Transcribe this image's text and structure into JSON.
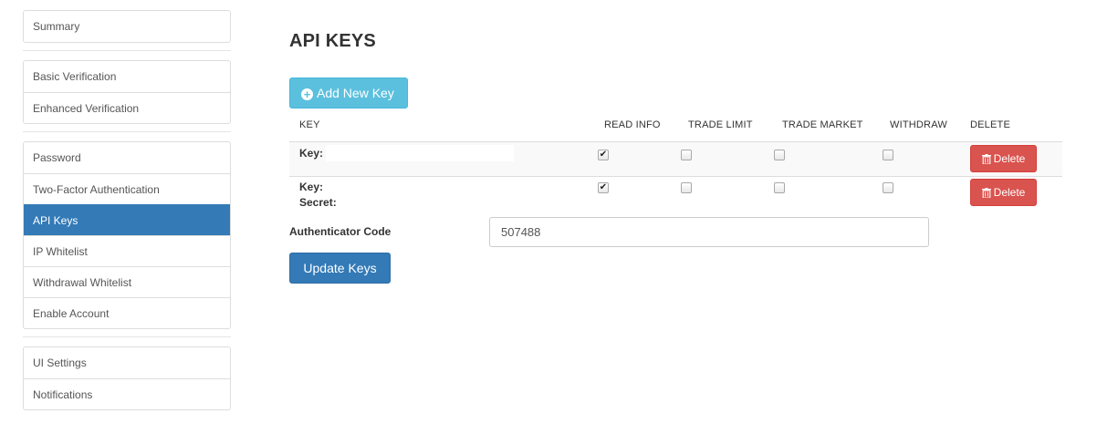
{
  "sidebar": {
    "groups": [
      {
        "items": [
          {
            "label": "Summary"
          }
        ]
      },
      {
        "items": [
          {
            "label": "Basic Verification"
          },
          {
            "label": "Enhanced Verification"
          }
        ]
      },
      {
        "items": [
          {
            "label": "Password"
          },
          {
            "label": "Two-Factor Authentication"
          },
          {
            "label": "API Keys",
            "active": true
          },
          {
            "label": "IP Whitelist"
          },
          {
            "label": "Withdrawal Whitelist"
          },
          {
            "label": "Enable Account"
          }
        ]
      },
      {
        "items": [
          {
            "label": "UI Settings"
          },
          {
            "label": "Notifications"
          }
        ]
      }
    ]
  },
  "main": {
    "title": "API KEYS",
    "add_key_label": "Add New Key",
    "table": {
      "headers": [
        "KEY",
        "READ INFO",
        "TRADE LIMIT",
        "TRADE MARKET",
        "WITHDRAW",
        "DELETE"
      ],
      "rows": [
        {
          "key_label": "Key:",
          "secret_label": "",
          "read_info": true,
          "trade_limit": false,
          "trade_market": false,
          "withdraw": false,
          "delete_label": "Delete"
        },
        {
          "key_label": "Key:",
          "secret_label": "Secret:",
          "read_info": true,
          "trade_limit": false,
          "trade_market": false,
          "withdraw": false,
          "delete_label": "Delete"
        }
      ]
    },
    "auth": {
      "label": "Authenticator Code",
      "value": "507488"
    },
    "update_label": "Update Keys"
  },
  "colors": {
    "primary": "#337ab7",
    "info": "#5bc0de",
    "danger": "#d9534f"
  },
  "icons": {
    "add": "plus-circle-icon",
    "delete": "trash-icon",
    "check": "checkmark-icon"
  }
}
